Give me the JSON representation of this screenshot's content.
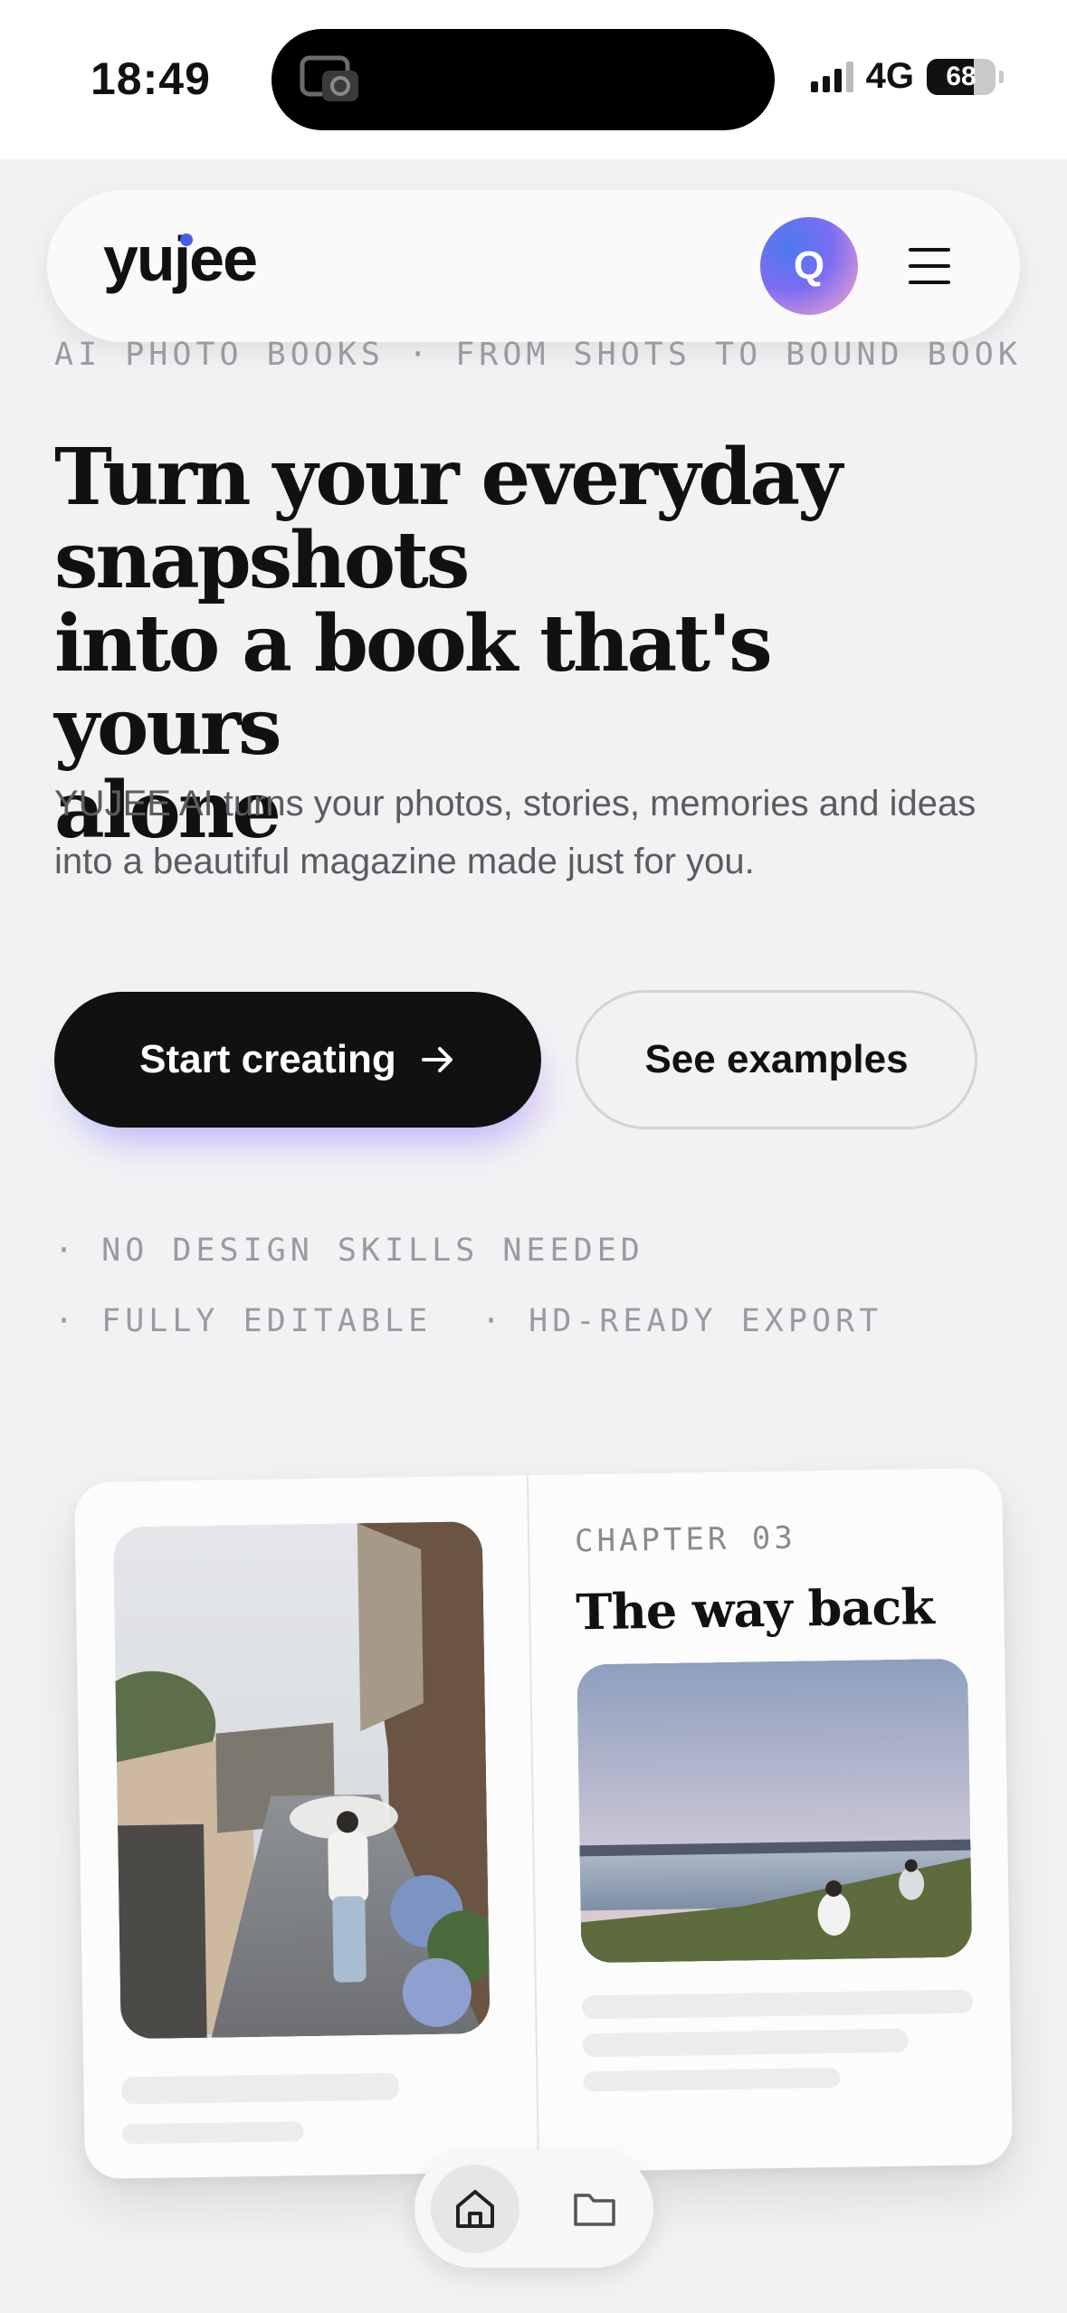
{
  "status_bar": {
    "time": "18:49",
    "network": "4G",
    "battery": "68",
    "battery_fraction": 0.68
  },
  "nav": {
    "logo": "yujee",
    "avatar_initial": "Q"
  },
  "hero": {
    "eyebrow": "AI PHOTO BOOKS · FROM SHOTS TO BOUND BOOK",
    "headline_line1": "Turn your everyday",
    "headline_line2": "snapshots",
    "headline_line3": "into a book that's yours",
    "headline_line4": "alone",
    "subtitle": "YUJEE AI turns your photos, stories, memories and ideas into a beautiful magazine made just for you.",
    "primary_cta": "Start creating",
    "secondary_cta": "See examples"
  },
  "features": [
    "· NO DESIGN SKILLS NEEDED",
    "· FULLY EDITABLE",
    "· HD-READY EXPORT"
  ],
  "book_preview": {
    "chapter": "CHAPTER 03",
    "title": "The way back"
  },
  "tabbar": {
    "items": [
      "home-icon",
      "folder-icon"
    ],
    "active": "home-icon"
  },
  "colors": {
    "primary": "#111111",
    "background": "#f2f2f4",
    "muted": "#9a9aa0",
    "accent": "#7b6df2"
  }
}
